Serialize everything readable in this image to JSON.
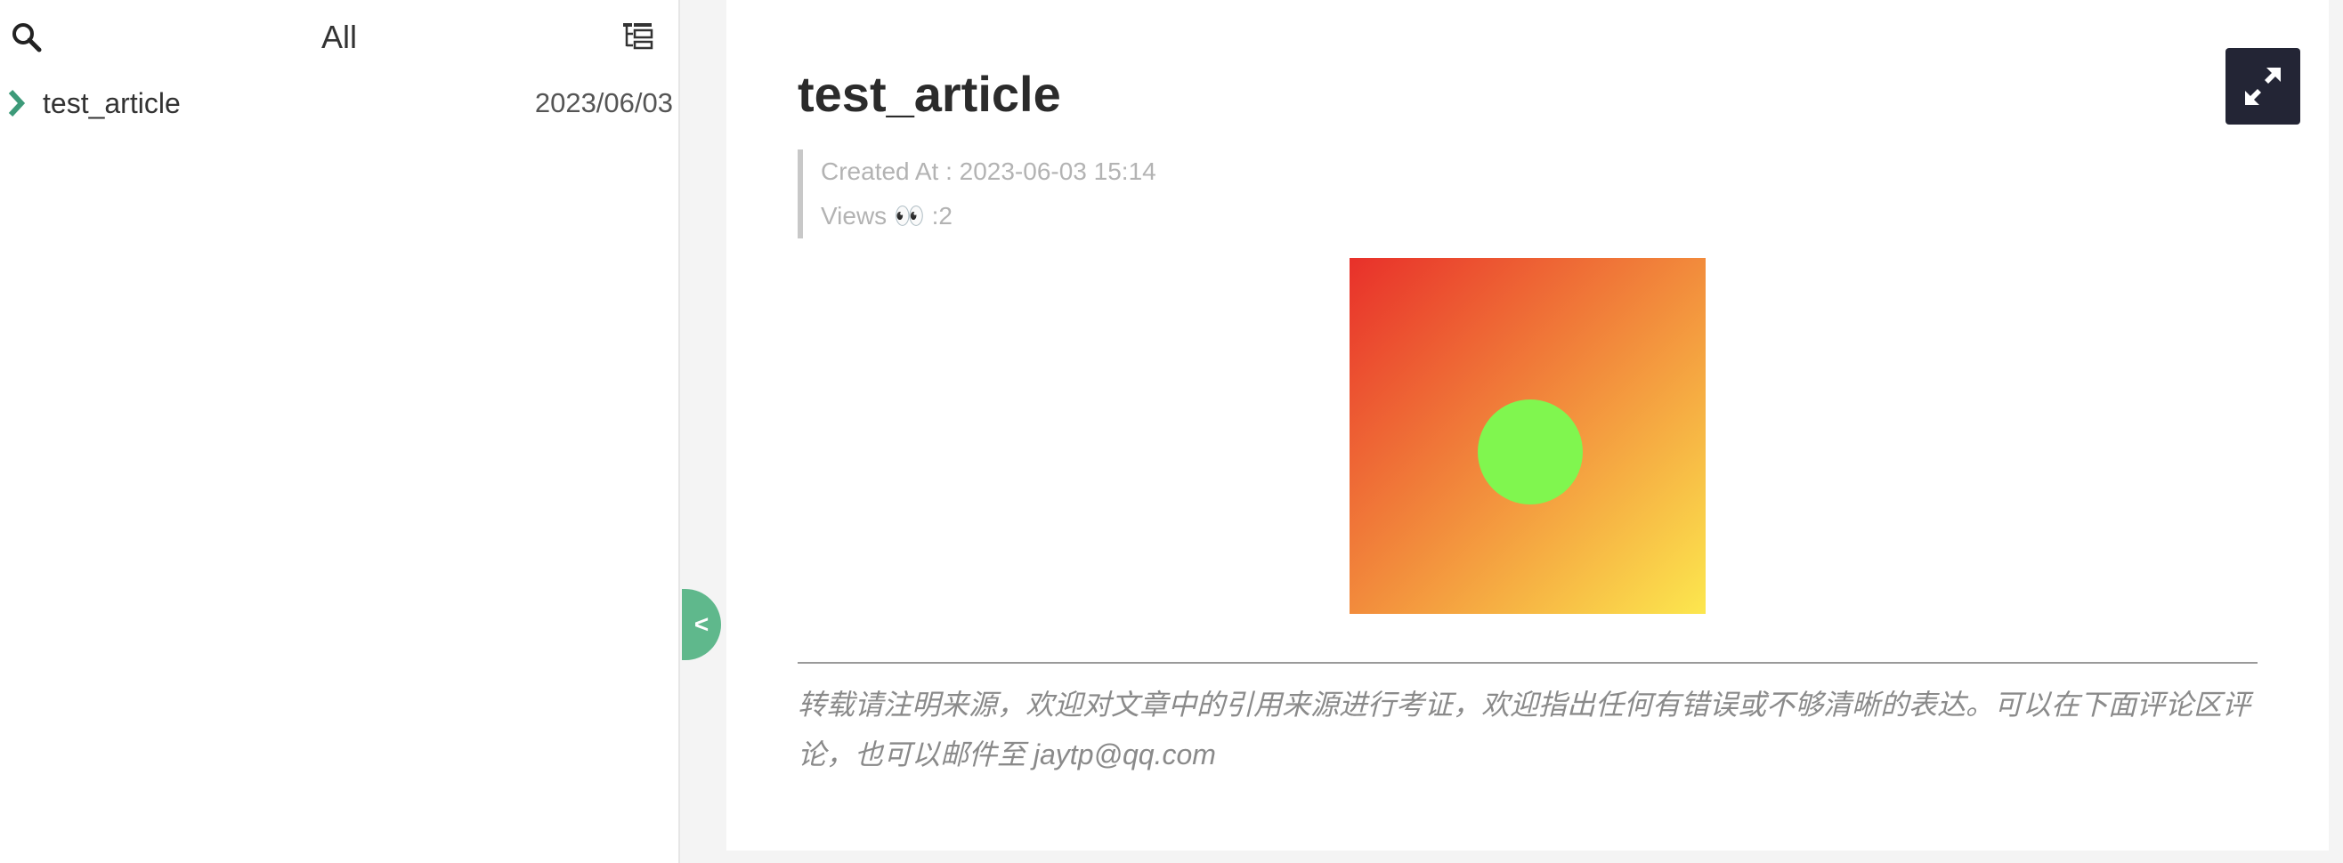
{
  "sidebar": {
    "filter_title": "All",
    "search_icon": "search-icon",
    "tree_icon": "tree-list-icon",
    "articles": [
      {
        "title": "test_article",
        "date": "2023/06/03",
        "icon": "chevron-right-icon"
      }
    ]
  },
  "toggle": {
    "label": "<"
  },
  "fullscreen": {
    "icon": "expand-icon"
  },
  "post": {
    "title": "test_article",
    "created_at": "Created At : 2023-06-03 15:14",
    "views": "Views 👀 :2",
    "figure_icon": "gradient-square-with-green-circle",
    "footer_note": "转载请注明来源，欢迎对文章中的引用来源进行考证，欢迎指出任何有错误或不够清晰的表达。可以在下面评论区评论，也可以邮件至 jaytp@qq.com"
  },
  "colors": {
    "accent_green": "#5fb88c",
    "chevron_green": "#3d9a79",
    "dark_button": "#232535",
    "gradient_start": "#e8302a",
    "gradient_end": "#fce74e",
    "circle_fill": "#80f64f"
  }
}
